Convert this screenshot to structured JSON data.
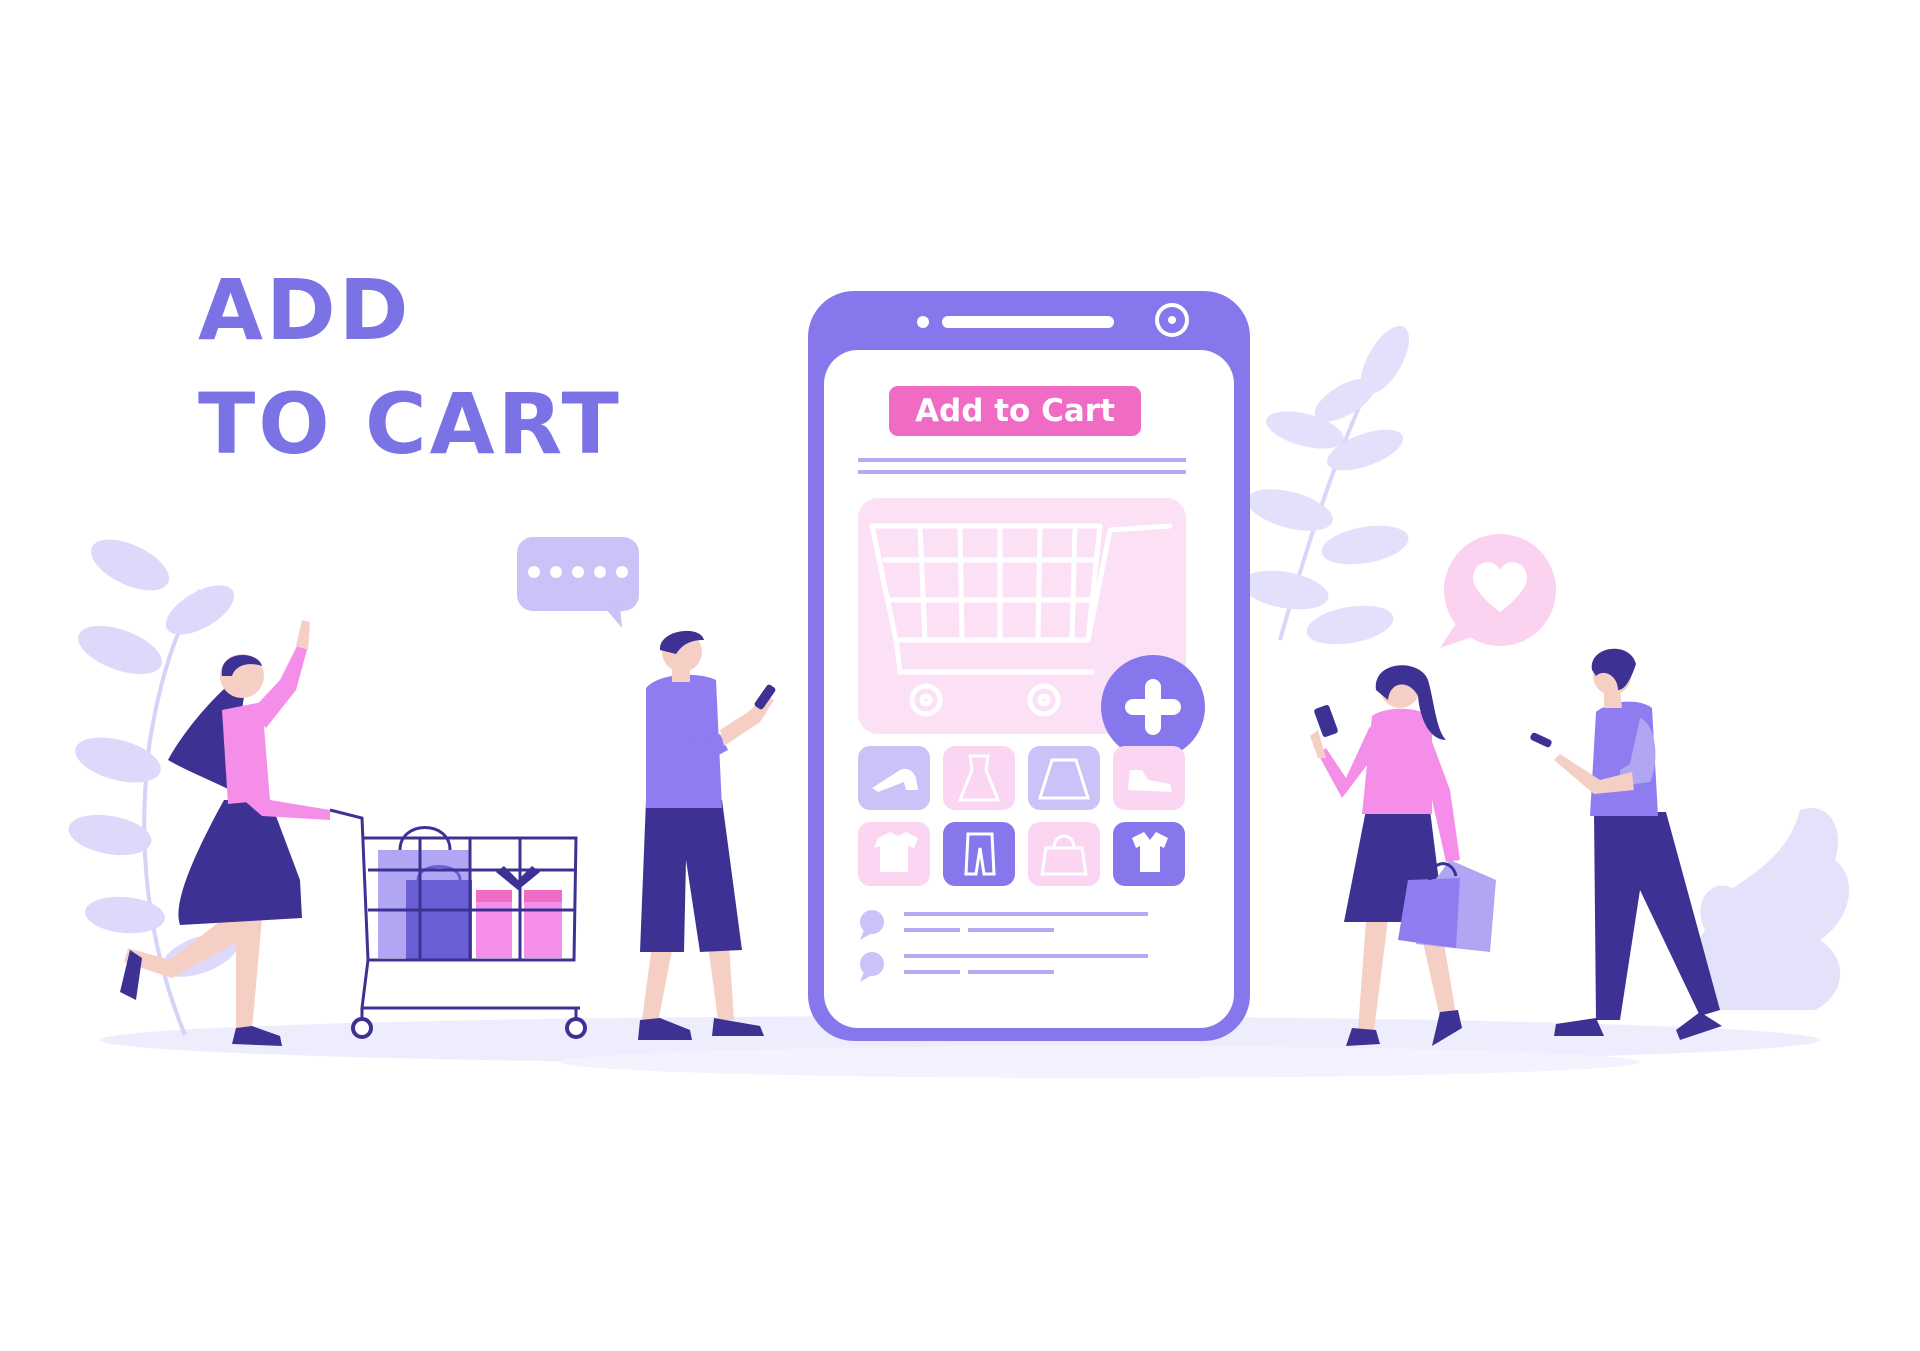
{
  "headline": {
    "line1": "ADD",
    "line2": "TO CART"
  },
  "phone": {
    "add_to_cart_label": "Add to Cart",
    "product_icons": [
      "high-heel-icon",
      "dress-icon",
      "skirt-icon",
      "sneaker-icon",
      "tshirt-icon",
      "pants-icon",
      "handbag-icon",
      "shirt-icon"
    ]
  },
  "colors": {
    "headline": "#7b72e6",
    "phone_frame": "#8678ec",
    "accent_pink": "#f06bc4",
    "light_pink": "#fce0f5",
    "leaf_lilac": "#dcd9fa",
    "skin": "#f6cfc4",
    "navy": "#3d3294",
    "shirt_purple": "#8f7cf0",
    "top_pink": "#f58ee9"
  }
}
